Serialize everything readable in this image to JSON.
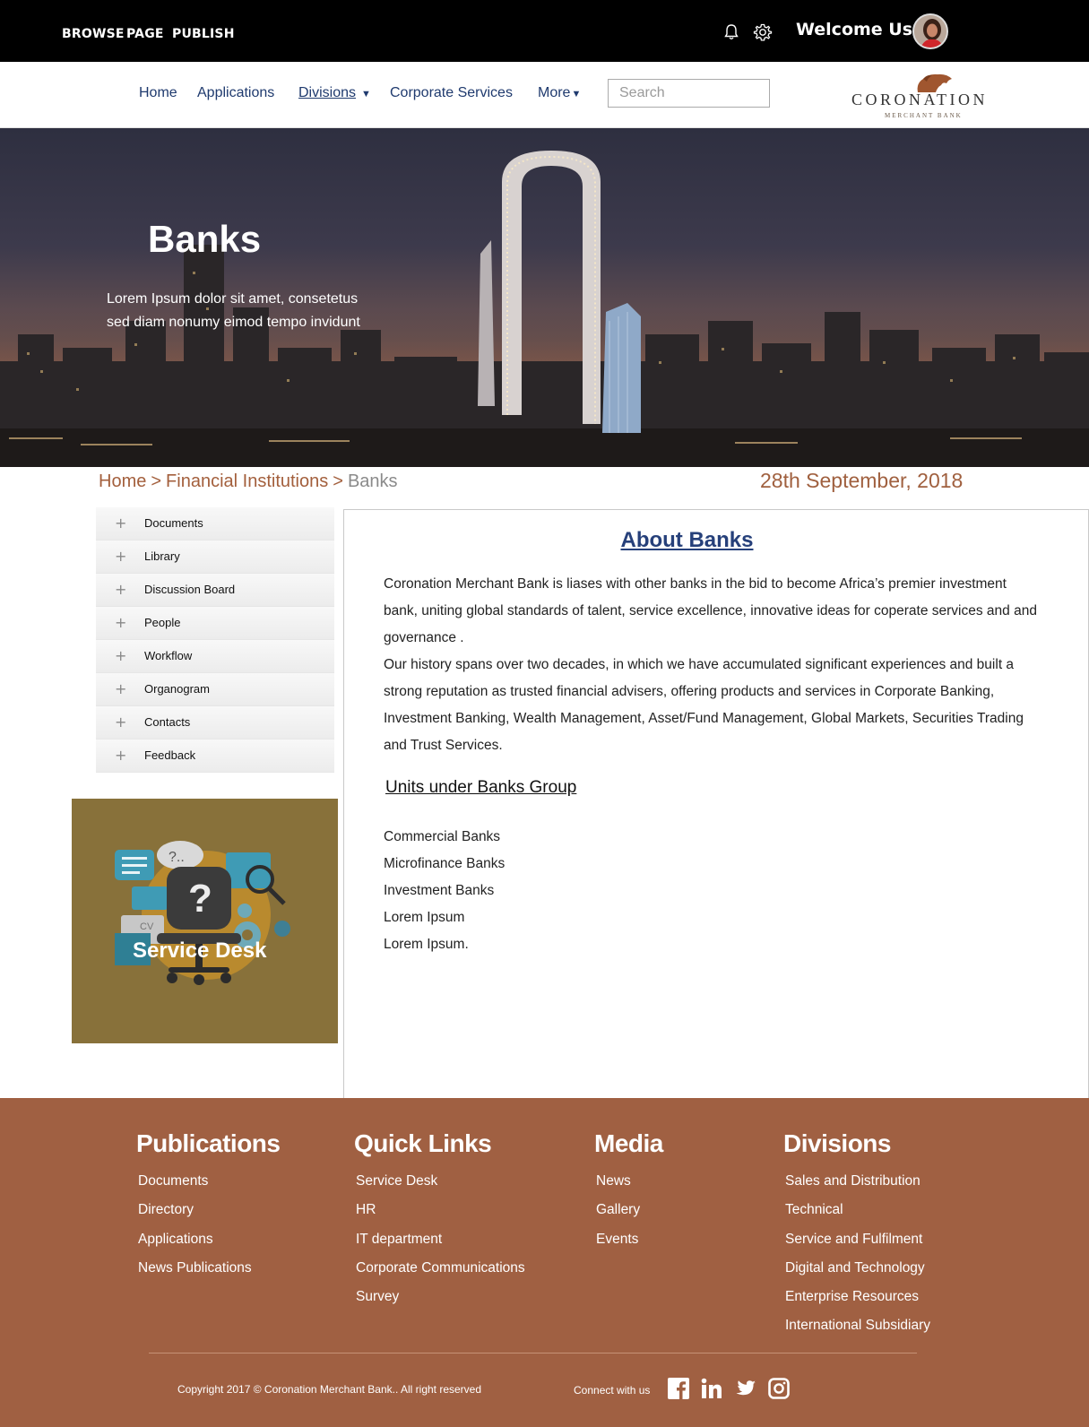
{
  "topbar": {
    "links": [
      "BROWSE",
      "PAGE",
      "PUBLISH"
    ],
    "welcome": "Welcome User",
    "icons": [
      "bell-icon",
      "gear-icon"
    ]
  },
  "nav": {
    "items": [
      "Home",
      "Applications",
      "Divisions",
      "Corporate Services",
      "More"
    ],
    "search_placeholder": "Search",
    "logo_name": "CORONATION",
    "logo_sub": "MERCHANT BANK"
  },
  "hero": {
    "title": "Banks",
    "subtitle": "Lorem Ipsum dolor sit amet, consetetus sed diam nonumy eimod tempo invidunt"
  },
  "breadcrumb": [
    "Home",
    "Financial Institutions",
    "Banks"
  ],
  "date": "28th September, 2018",
  "sidebar": {
    "items": [
      "Documents",
      "Library",
      "Discussion Board",
      "People",
      "Workflow",
      "Organogram",
      "Contacts",
      "Feedback"
    ],
    "service_desk": "Service Desk"
  },
  "main": {
    "title": "About Banks",
    "paragraph1": "Coronation Merchant Bank is liases with other banks in the bid to become Africa’s premier investment bank, uniting  global standards of talent, service excellence, innovative ideas  for coperate services and and governance .",
    "paragraph2": "Our history spans over two decades, in which we have accumulated significant experiences and built a strong reputation as trusted financial advisers, offering products and services in Corporate Banking, Investment Banking, Wealth Management, Asset/Fund Management, Global Markets, Securities Trading and Trust Services.",
    "units_title": "Units under Banks Group",
    "units": [
      "Commercial Banks",
      "Microfinance Banks",
      "Investment Banks",
      "Lorem Ipsum",
      "Lorem Ipsum."
    ]
  },
  "footer": {
    "publications": {
      "title": "Publications",
      "links": [
        "Documents",
        "Directory",
        "Applications",
        "News Publications"
      ]
    },
    "quick_links": {
      "title": "Quick Links",
      "links": [
        "Service Desk",
        "HR",
        "IT department",
        "Corporate Communications",
        "Survey"
      ]
    },
    "media": {
      "title": "Media",
      "links": [
        "News",
        "Gallery",
        "Events"
      ]
    },
    "divisions": {
      "title": "Divisions",
      "links": [
        "Sales and Distribution",
        "Technical",
        "Service and Fulfilment",
        "Digital and Technology",
        "Enterprise Resources",
        "International Subsidiary"
      ]
    },
    "copyright": "Copyright 2017 © Coronation Merchant Bank.. All right reserved",
    "connect": "Connect with us",
    "social_icons": [
      "facebook-icon",
      "linkedin-icon",
      "twitter-icon",
      "instagram-icon"
    ]
  },
  "colors": {
    "footer_bg": "#a06042",
    "nav_text": "#1f3a6e",
    "accent": "#a35f3c",
    "service_desk_bg": "#88713a"
  }
}
